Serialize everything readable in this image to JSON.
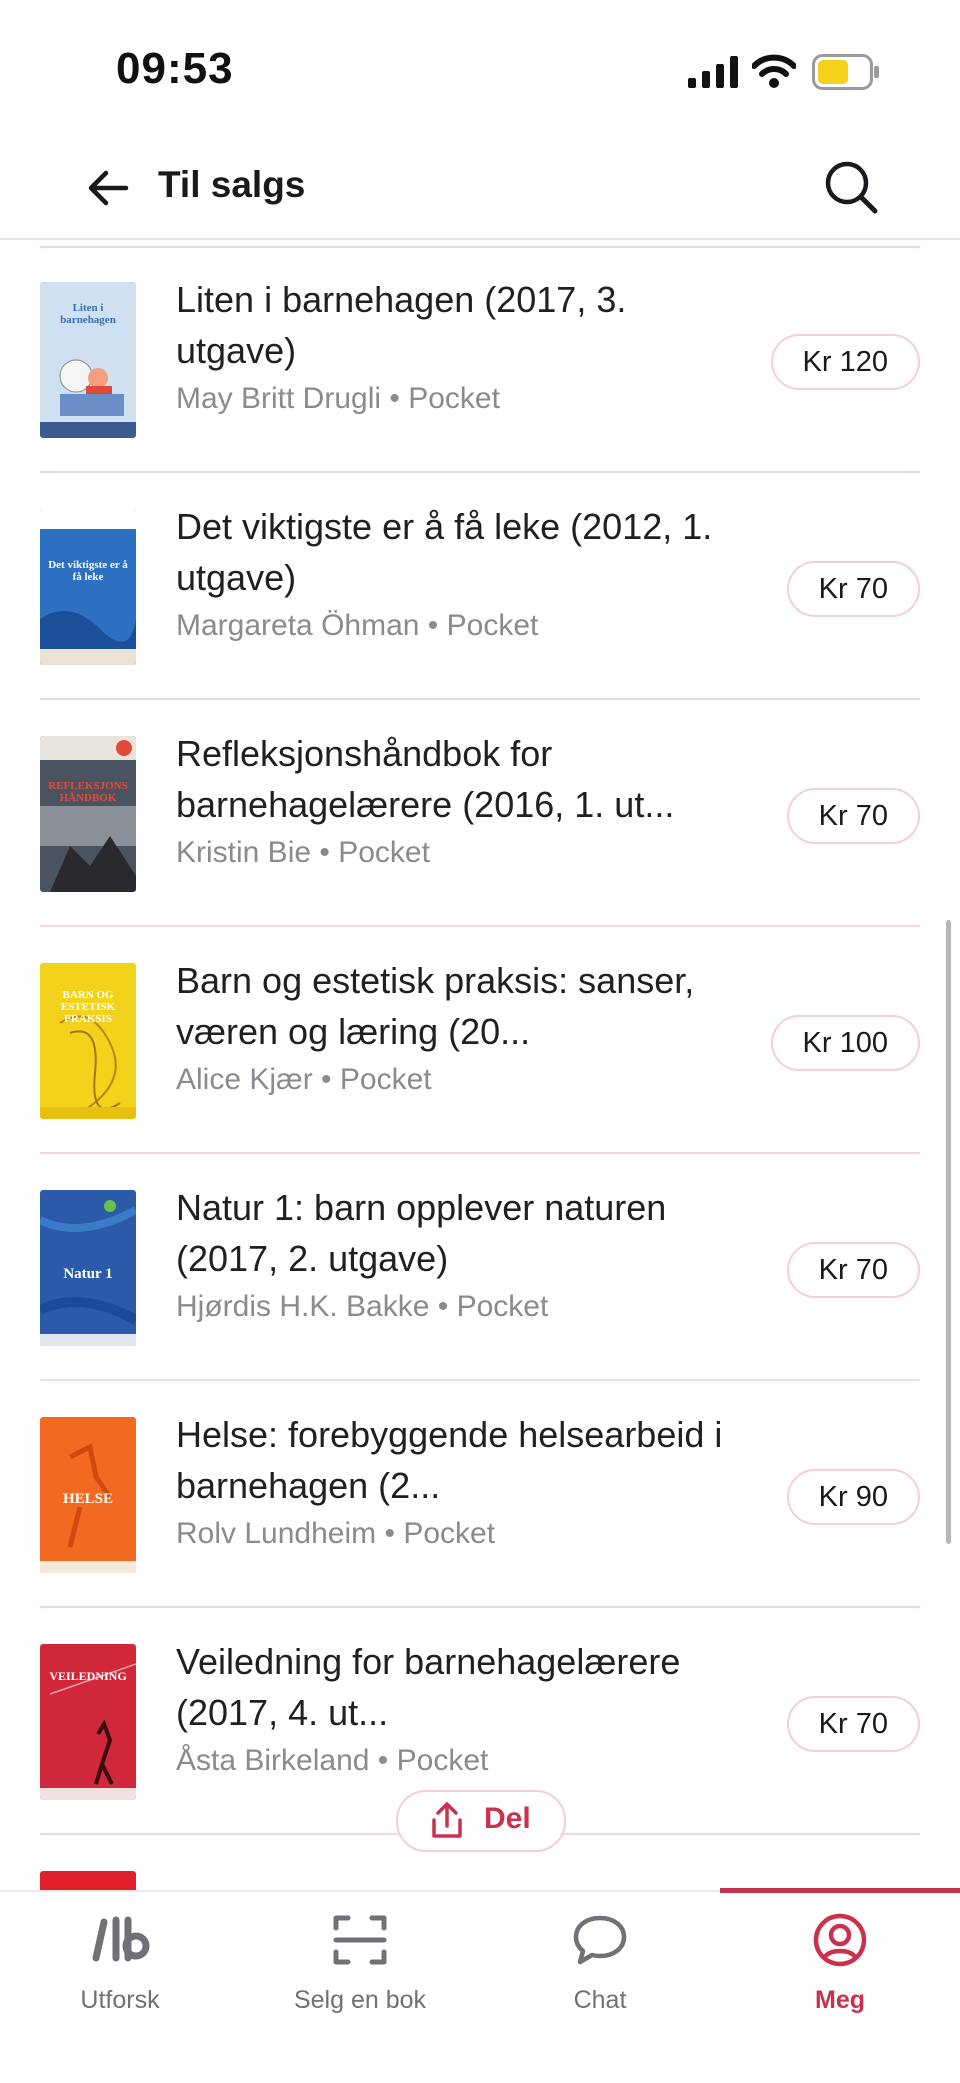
{
  "status_bar": {
    "time": "09:53"
  },
  "header": {
    "title": "Til salgs"
  },
  "books": [
    {
      "title": "Liten i barnehagen (2017, 3. utgave)",
      "author": "May Britt Drugli",
      "format": "Pocket",
      "price": "Kr 120"
    },
    {
      "title": "Det viktigste er å få leke (2012, 1. utgave)",
      "author": "Margareta Öhman",
      "format": "Pocket",
      "price": "Kr 70"
    },
    {
      "title": "Refleksjonshåndbok for barnehagelærere (2016, 1. ut...",
      "author": "Kristin Bie",
      "format": "Pocket",
      "price": "Kr 70"
    },
    {
      "title": "Barn og estetisk praksis: sanser, væren og læring (20...",
      "author": "Alice Kjær",
      "format": "Pocket",
      "price": "Kr 100"
    },
    {
      "title": "Natur 1: barn opplever naturen (2017, 2. utgave)",
      "author": "Hjørdis H.K. Bakke",
      "format": "Pocket",
      "price": "Kr 70"
    },
    {
      "title": "Helse: forebyggende helsearbeid i barnehagen (2...",
      "author": "Rolv Lundheim",
      "format": "Pocket",
      "price": "Kr 90"
    },
    {
      "title": "Veiledning for barnehagelærere (2017, 4. ut...",
      "author": "Åsta Birkeland",
      "format": "Pocket",
      "price": "Kr 70"
    }
  ],
  "covers": [
    {
      "text": "Liten i barnehagen",
      "bg": "#cfe0f0",
      "fg": "#3a6fb0"
    },
    {
      "text": "Det viktigste er å få leke",
      "bg": "#2d6fc0",
      "fg": "#ffffff"
    },
    {
      "text": "REFLEKSJONS HÅNDBOK",
      "bg": "#4a5360",
      "fg": "#e04a3a"
    },
    {
      "text": "BARN OG ESTETISK PRAKSIS",
      "bg": "#f2d21a",
      "fg": "#ffffff"
    },
    {
      "text": "Natur 1",
      "bg": "#2a5aa8",
      "fg": "#ffffff"
    },
    {
      "text": "HELSE",
      "bg": "#f26a22",
      "fg": "#ffffff"
    },
    {
      "text": "VEILEDNING",
      "bg": "#d0283a",
      "fg": "#ffffff"
    }
  ],
  "share_button": {
    "label": "Del"
  },
  "tabs": [
    {
      "label": "Utforsk",
      "icon": "logo-icon",
      "active": false
    },
    {
      "label": "Selg en bok",
      "icon": "scan-icon",
      "active": false
    },
    {
      "label": "Chat",
      "icon": "chat-bubble-icon",
      "active": false
    },
    {
      "label": "Meg",
      "icon": "profile-icon",
      "active": true
    }
  ],
  "colors": {
    "accent": "#c8324f",
    "price_border": "#f2cfd6",
    "separator": "#f3d6dc",
    "muted_text": "#8a8a90"
  }
}
